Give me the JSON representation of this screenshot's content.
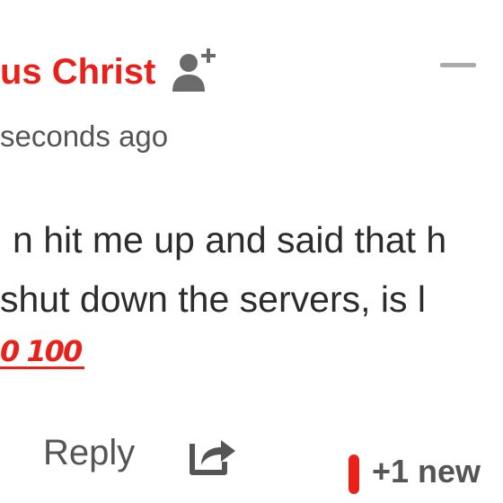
{
  "comment": {
    "author": "us Christ",
    "timestamp": "seconds ago",
    "body_line_1": "n hit me up and said that h",
    "body_line_2": " shut down the servers, is l",
    "emoji_100": "0 100",
    "follow_icon": "add-user-icon",
    "collapse_icon": "minus-icon"
  },
  "actions": {
    "reply_label": "Reply",
    "share_icon": "share-icon",
    "new_replies_label": "+1 new"
  },
  "colors": {
    "accent": "#e8221b",
    "text_primary": "#2c2c2c",
    "text_secondary": "#555555",
    "icon_gray": "#6b6b6b",
    "collapse_gray": "#aaaaaa"
  }
}
